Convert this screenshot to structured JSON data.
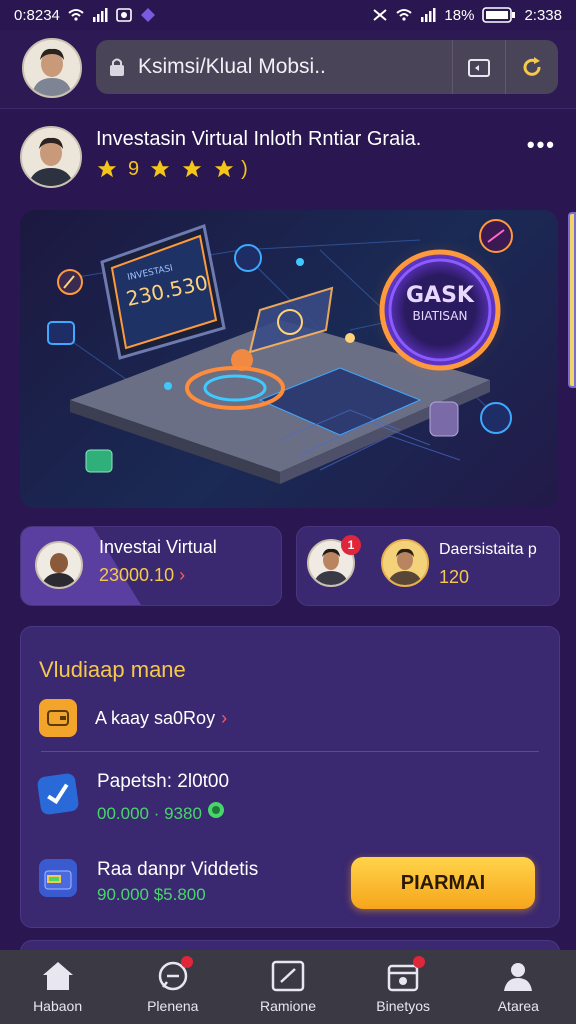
{
  "status_bar": {
    "time_left": "0:8234",
    "battery": "18%",
    "time_right": "2:338"
  },
  "browser": {
    "url": "Ksimsi/Klual Mobsi..",
    "icons": [
      "lock-icon",
      "tab-switch-icon",
      "refresh-icon"
    ]
  },
  "post": {
    "title": "Investasin Virtual Inloth Rntiar Graia.",
    "rating_prefix": "9",
    "rating_suffix": ")",
    "stars": 3,
    "more": "•••"
  },
  "hero": {
    "screen_value": "230.530",
    "screen_label": "INVESTASI",
    "badge_line1": "GASK",
    "badge_line2": "BIATISAN"
  },
  "cards": {
    "left": {
      "title": "Investai Virtual",
      "amount": "23000.10",
      "arrow": "›"
    },
    "right": {
      "title": "Daersistaita p",
      "amount": "120 ",
      "badge": "1"
    }
  },
  "panel": {
    "title": "Vludiaap mane",
    "item1": {
      "label": "A kaay sa0Roy",
      "arrow": "›"
    },
    "item2": {
      "title": "Papetsh: 2l0t00",
      "value": "00.000 · 9380"
    },
    "item3": {
      "title": "Raa danpr Viddetis",
      "value": "90.000 $5.800"
    },
    "cta": "PIARMAI"
  },
  "bottom_nav": [
    {
      "label": "Habaon",
      "icon": "home-icon"
    },
    {
      "label": "Plenena",
      "icon": "chat-icon"
    },
    {
      "label": "Ramione",
      "icon": "edit-icon"
    },
    {
      "label": "Binetyos",
      "icon": "calendar-icon"
    },
    {
      "label": "Atarea",
      "icon": "profile-icon"
    }
  ],
  "colors": {
    "background": "#2a1650",
    "accent_gold": "#f7c94a",
    "accent_green": "#48d66a",
    "card": "#3a2870",
    "nav": "#3b3944"
  }
}
